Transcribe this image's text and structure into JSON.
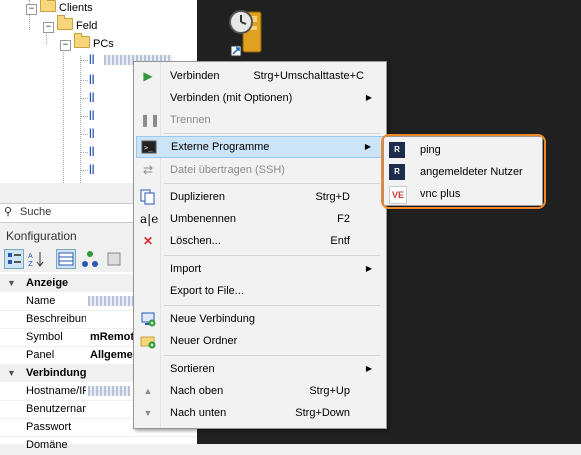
{
  "tree": {
    "nodes": [
      {
        "label": "Clients"
      },
      {
        "label": "Feld"
      },
      {
        "label": "PCs"
      }
    ]
  },
  "search": {
    "placeholder": "Suche"
  },
  "config": {
    "title": "Konfiguration",
    "categories": [
      {
        "label": "Anzeige"
      },
      {
        "label": "Verbindung"
      }
    ],
    "rows": [
      {
        "name": "Name",
        "value": ""
      },
      {
        "name": "Beschreibung",
        "value": ""
      },
      {
        "name": "Symbol",
        "value": "mRemot"
      },
      {
        "name": "Panel",
        "value": "Allgeme"
      },
      {
        "name": "Hostname/IP",
        "value": ""
      },
      {
        "name": "Benutzername",
        "value": ""
      },
      {
        "name": "Passwort",
        "value": ""
      },
      {
        "name": "Domäne",
        "value": ""
      }
    ]
  },
  "menu": {
    "items": [
      {
        "label": "Verbinden",
        "shortcut": "Strg+Umschalttaste+C"
      },
      {
        "label": "Verbinden (mit Optionen)"
      },
      {
        "label": "Trennen"
      },
      {
        "label": "Externe Programme"
      },
      {
        "label": "Datei übertragen (SSH)"
      },
      {
        "label": "Duplizieren",
        "shortcut": "Strg+D"
      },
      {
        "label": "Umbenennen",
        "shortcut": "F2"
      },
      {
        "label": "Löschen...",
        "shortcut": "Entf"
      },
      {
        "label": "Import"
      },
      {
        "label": "Export to File..."
      },
      {
        "label": "Neue Verbindung"
      },
      {
        "label": "Neuer Ordner"
      },
      {
        "label": "Sortieren"
      },
      {
        "label": "Nach oben",
        "shortcut": "Strg+Up"
      },
      {
        "label": "Nach unten",
        "shortcut": "Strg+Down"
      }
    ]
  },
  "submenu": {
    "items": [
      {
        "label": "ping"
      },
      {
        "label": "angemeldeter Nutzer"
      },
      {
        "label": "vnc plus"
      }
    ]
  },
  "colors": {
    "highlight": "#cce4f7",
    "outline": "#f08a24",
    "dark_bg": "#202020"
  }
}
